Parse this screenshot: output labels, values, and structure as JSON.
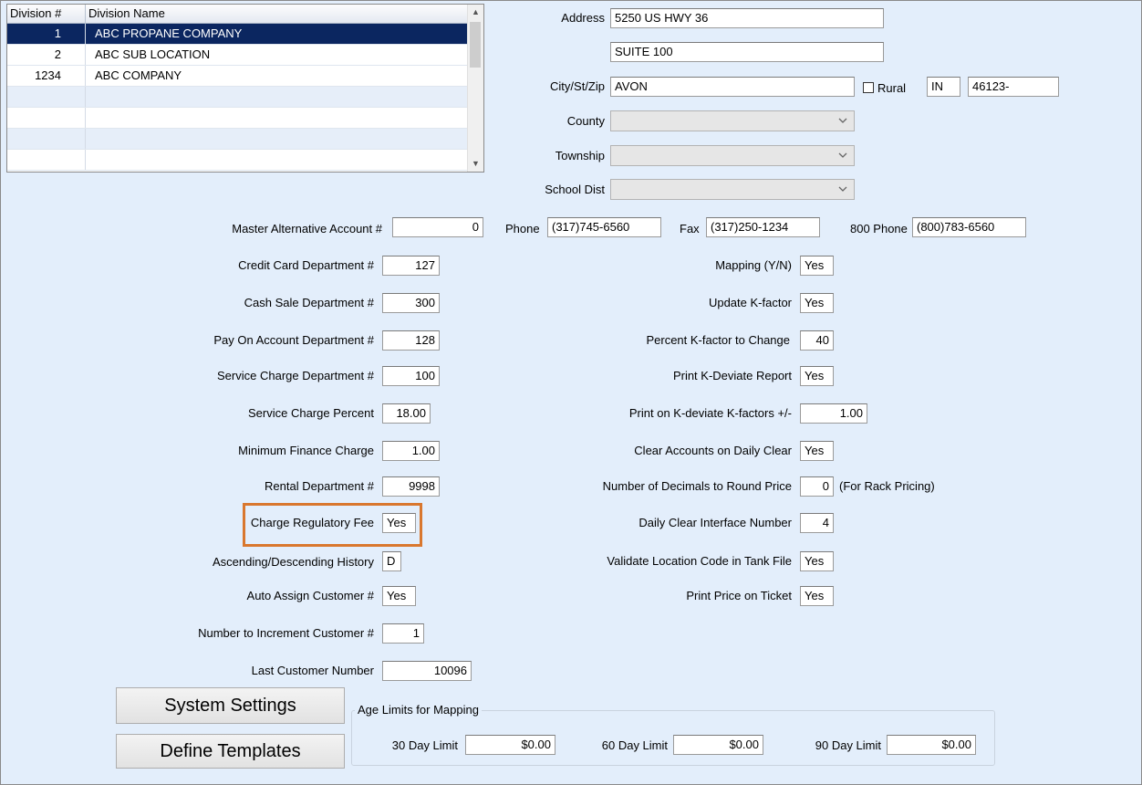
{
  "grid": {
    "headers": {
      "division_num": "Division #",
      "division_name": "Division Name"
    },
    "rows": [
      {
        "num": "1",
        "name": "ABC PROPANE COMPANY",
        "selected": true
      },
      {
        "num": "2",
        "name": "ABC SUB LOCATION",
        "selected": false
      },
      {
        "num": "1234",
        "name": "ABC COMPANY",
        "selected": false
      }
    ]
  },
  "address": {
    "label": "Address",
    "line1": "5250 US HWY 36",
    "line2": "SUITE 100",
    "city_label": "City/St/Zip",
    "city": "AVON",
    "rural_label": "Rural",
    "rural_checked": false,
    "state": "IN",
    "zip": "46123-",
    "county_label": "County",
    "township_label": "Township",
    "school_label": "School Dist"
  },
  "contact": {
    "master_alt_label": "Master Alternative Account #",
    "master_alt_value": "0",
    "phone_label": "Phone",
    "phone": "(317)745-6560",
    "fax_label": "Fax",
    "fax": "(317)250-1234",
    "phone800_label": "800 Phone",
    "phone800": "(800)783-6560"
  },
  "left_fields": [
    {
      "label": "Credit Card Department #",
      "value": "127"
    },
    {
      "label": "Cash Sale Department #",
      "value": "300"
    },
    {
      "label": "Pay On Account Department #",
      "value": "128"
    },
    {
      "label": "Service Charge Department #",
      "value": "100"
    },
    {
      "label": "Service Charge Percent",
      "value": "18.00"
    },
    {
      "label": "Minimum Finance Charge",
      "value": "1.00"
    },
    {
      "label": "Rental Department #",
      "value": "9998"
    },
    {
      "label": "Charge Regulatory Fee",
      "value": "Yes"
    },
    {
      "label": "Ascending/Descending History",
      "value": "D"
    },
    {
      "label": "Auto Assign Customer #",
      "value": "Yes"
    },
    {
      "label": "Number to Increment Customer #",
      "value": "1"
    },
    {
      "label": "Last Customer Number",
      "value": "10096"
    }
  ],
  "right_fields": [
    {
      "label": "Mapping (Y/N)",
      "value": "Yes"
    },
    {
      "label": "Update K-factor",
      "value": "Yes"
    },
    {
      "label": "Percent K-factor to Change",
      "value": "40"
    },
    {
      "label": "Print K-Deviate Report",
      "value": "Yes"
    },
    {
      "label": "Print on K-deviate K-factors +/-",
      "value": "1.00"
    },
    {
      "label": "Clear Accounts on Daily Clear",
      "value": "Yes"
    },
    {
      "label": "Number of Decimals to Round Price",
      "value": "0",
      "note": "(For Rack Pricing)"
    },
    {
      "label": "Daily Clear Interface Number",
      "value": "4"
    },
    {
      "label": "Validate Location Code in Tank File",
      "value": "Yes"
    },
    {
      "label": "Print Price on Ticket",
      "value": "Yes"
    }
  ],
  "buttons": {
    "system_settings": "System Settings",
    "define_templates": "Define Templates"
  },
  "age_limits": {
    "title": "Age Limits for Mapping",
    "day30_label": "30 Day Limit",
    "day30": "$0.00",
    "day60_label": "60 Day Limit",
    "day60": "$0.00",
    "day90_label": "90 Day Limit",
    "day90": "$0.00"
  },
  "colors": {
    "background": "#e3eefb",
    "selection": "#0b2660",
    "highlight_border": "#d9772e"
  }
}
